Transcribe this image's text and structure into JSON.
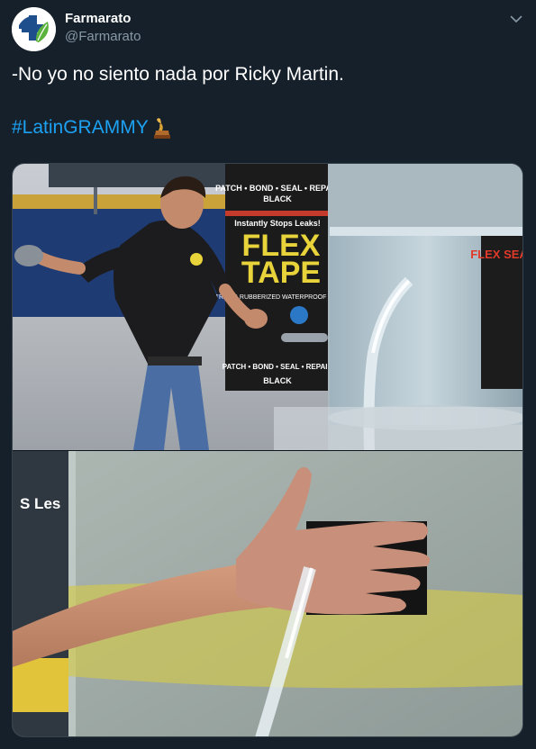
{
  "user": {
    "display_name": "Farmarato",
    "handle": "@Farmarato"
  },
  "tweet": {
    "text": "-No yo no siento nada por Ricky Martin.",
    "hashtag": "#LatinGRAMMY",
    "emoji_icon": "grammy-trophy-icon"
  },
  "media": {
    "product_brand": "FLEX",
    "product_name": "TAPE",
    "product_color": "BLACK",
    "product_slogan": "Instantly Stops Leaks!",
    "product_tagline": "PATCH • BOND • SEAL • REPAIR",
    "product_tagline_bottom": "PATCH • BOND • SEAL • REPAIR",
    "product_desc": "STRONG RUBBERIZED WATERPROOF TAPE",
    "tank_label": "FLEX SEAL",
    "sidebar_sign": "S Les"
  },
  "colors": {
    "background": "#15202b",
    "link": "#1da1f2",
    "secondary_text": "#8899a6"
  }
}
